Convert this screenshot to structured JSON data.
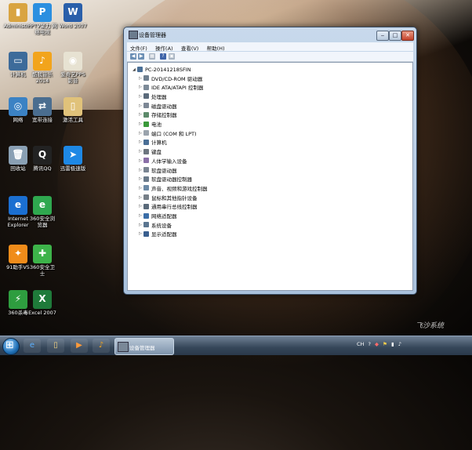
{
  "desktop": {
    "icons": [
      {
        "label": "Administr...",
        "icon": "user-folder-icon",
        "color": "#d9a441",
        "glyph": "▮"
      },
      {
        "label": "PPTV聚力 网络电视",
        "icon": "pptv-icon",
        "color": "#2b8fe0",
        "glyph": "P"
      },
      {
        "label": "Word 2007",
        "icon": "word-icon",
        "color": "#2a5faa",
        "glyph": "W"
      },
      {
        "label": "计算机",
        "icon": "computer-icon",
        "color": "#3d6b9a",
        "glyph": "▭"
      },
      {
        "label": "酷我音乐 2014",
        "icon": "kuwo-icon",
        "color": "#f2a41c",
        "glyph": "♪"
      },
      {
        "label": "爱奇艺PPS 影音",
        "icon": "pps-icon",
        "color": "#e7e2d2",
        "glyph": "◉"
      },
      {
        "label": "网络",
        "icon": "network-icon",
        "color": "#3b82c4",
        "glyph": "◎"
      },
      {
        "label": "宽带连接",
        "icon": "broadband-icon",
        "color": "#4a6d8f",
        "glyph": "⇄"
      },
      {
        "label": "激活工具",
        "icon": "activation-tool-icon",
        "color": "#e0c27a",
        "glyph": "▯"
      },
      {
        "label": "回收站",
        "icon": "recycle-bin-icon",
        "color": "#8aa0b4",
        "glyph": "🗑"
      },
      {
        "label": "腾讯QQ",
        "icon": "qq-icon",
        "color": "#222222",
        "glyph": "Q"
      },
      {
        "label": "迅雷极速版",
        "icon": "xunlei-icon",
        "color": "#1e88e5",
        "glyph": "➤"
      },
      {
        "label": "Internet Explorer",
        "icon": "ie-icon",
        "color": "#1b6fd1",
        "glyph": "e"
      },
      {
        "label": "360安全浏览器",
        "icon": "360-browser-icon",
        "color": "#2fa84f",
        "glyph": "e"
      },
      {
        "label": "91助手V5",
        "icon": "91-assistant-icon",
        "color": "#f08c1a",
        "glyph": "✦"
      },
      {
        "label": "360安全卫士",
        "icon": "360-safe-icon",
        "color": "#3db34a",
        "glyph": "✚"
      },
      {
        "label": "360杀毒",
        "icon": "360-antivirus-icon",
        "color": "#2e9d3f",
        "glyph": "⚡"
      },
      {
        "label": "Excel 2007",
        "icon": "excel-icon",
        "color": "#1f7a3a",
        "glyph": "X"
      }
    ]
  },
  "window": {
    "title": "设备管理器",
    "buttons": {
      "minimize": "‒",
      "maximize": "□",
      "close": "✕"
    },
    "menu": [
      "文件(F)",
      "操作(A)",
      "查看(V)",
      "帮助(H)"
    ],
    "root": "PC-20141218SFIN",
    "devices": [
      {
        "label": "DVD/CD-ROM 驱动器",
        "color": "#6f7f8f"
      },
      {
        "label": "IDE ATA/ATAPI 控制器",
        "color": "#7c8a98"
      },
      {
        "label": "处理器",
        "color": "#5b6b7b"
      },
      {
        "label": "磁盘驱动器",
        "color": "#7c8795"
      },
      {
        "label": "存储控制器",
        "color": "#5c8a6a"
      },
      {
        "label": "电池",
        "color": "#3a9a3a"
      },
      {
        "label": "端口 (COM 和 LPT)",
        "color": "#9aa3ad"
      },
      {
        "label": "计算机",
        "color": "#4a6f96"
      },
      {
        "label": "键盘",
        "color": "#6d7680"
      },
      {
        "label": "人体学输入设备",
        "color": "#8a6fa8"
      },
      {
        "label": "软盘驱动器",
        "color": "#7a8592"
      },
      {
        "label": "软盘驱动器控制器",
        "color": "#6a7a8a"
      },
      {
        "label": "声音、视频和游戏控制器",
        "color": "#6c8aa6"
      },
      {
        "label": "鼠标和其他指针设备",
        "color": "#767f88"
      },
      {
        "label": "通用串行总线控制器",
        "color": "#5a6a7a"
      },
      {
        "label": "网络适配器",
        "color": "#3b6ea8"
      },
      {
        "label": "系统设备",
        "color": "#5a7590"
      },
      {
        "label": "显示适配器",
        "color": "#3a5f8f"
      }
    ]
  },
  "taskbar": {
    "task_label": "设备管理器",
    "tray": {
      "lang": "CH",
      "icons": [
        "?",
        "◆",
        "⚑",
        "▮",
        "♪"
      ]
    }
  },
  "watermark": "飞沙系统"
}
